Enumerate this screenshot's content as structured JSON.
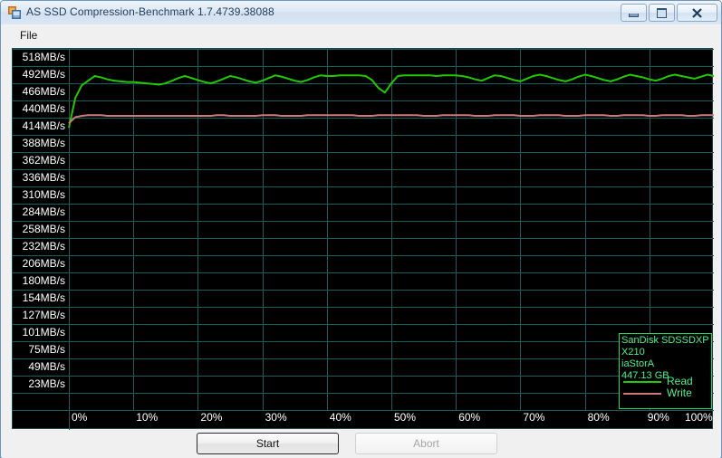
{
  "window": {
    "title": "AS SSD Compression-Benchmark 1.7.4739.38088",
    "icon": "app-icon",
    "controls": {
      "minimize": "Minimize",
      "maximize": "Maximize",
      "close": "Close"
    }
  },
  "menu": {
    "items": [
      {
        "label": "File"
      }
    ]
  },
  "legend": {
    "device_line1": "SanDisk SDSSDXP",
    "device_line2": "X210",
    "driver": "iaStorA",
    "capacity": "447.13 GB",
    "entries": [
      {
        "label": "Read",
        "color": "#22c800"
      },
      {
        "label": "Write",
        "color": "#cc7b7b"
      }
    ]
  },
  "buttons": {
    "start": "Start",
    "abort": "Abort"
  },
  "colors": {
    "read": "#22c800",
    "write": "#cc7b7b",
    "grid": "#1d5c5c",
    "plot_background": "#000000",
    "axis_text": "#ffffff",
    "legend_text": "#4df08a",
    "legend_border": "#2bd46b"
  },
  "chart_data": {
    "type": "line",
    "title": "",
    "xlabel": "",
    "ylabel": "",
    "grid": true,
    "legend_position": "bottom-right",
    "xlim": [
      0,
      100
    ],
    "ylim": [
      0,
      518
    ],
    "ytick_labels": [
      "518MB/s",
      "492MB/s",
      "466MB/s",
      "440MB/s",
      "414MB/s",
      "388MB/s",
      "362MB/s",
      "336MB/s",
      "310MB/s",
      "284MB/s",
      "258MB/s",
      "232MB/s",
      "206MB/s",
      "180MB/s",
      "154MB/s",
      "127MB/s",
      "101MB/s",
      "75MB/s",
      "49MB/s",
      "23MB/s"
    ],
    "ytick_values": [
      518,
      492,
      466,
      440,
      414,
      388,
      362,
      336,
      310,
      284,
      258,
      232,
      206,
      180,
      154,
      127,
      101,
      75,
      49,
      23
    ],
    "xtick_labels": [
      "0%",
      "10%",
      "20%",
      "30%",
      "40%",
      "50%",
      "60%",
      "70%",
      "80%",
      "90%",
      "100%"
    ],
    "xtick_values": [
      0,
      10,
      20,
      30,
      40,
      50,
      60,
      70,
      80,
      90,
      100
    ],
    "x": [
      0,
      1,
      2,
      3,
      4,
      5,
      6,
      7,
      8,
      9,
      10,
      11,
      12,
      13,
      14,
      15,
      16,
      17,
      18,
      19,
      20,
      21,
      22,
      23,
      24,
      25,
      26,
      27,
      28,
      29,
      30,
      31,
      32,
      33,
      34,
      35,
      36,
      37,
      38,
      39,
      40,
      41,
      42,
      43,
      44,
      45,
      46,
      47,
      48,
      49,
      50,
      51,
      52,
      53,
      54,
      55,
      56,
      57,
      58,
      59,
      60,
      61,
      62,
      63,
      64,
      65,
      66,
      67,
      68,
      69,
      70,
      71,
      72,
      73,
      74,
      75,
      76,
      77,
      78,
      79,
      80,
      81,
      82,
      83,
      84,
      85,
      86,
      87,
      88,
      89,
      90,
      91,
      92,
      93,
      94,
      95,
      96,
      97,
      98,
      99,
      100
    ],
    "series": [
      {
        "name": "Read",
        "color": "#22c800",
        "values": [
          425,
          470,
          489,
          496,
          503,
          501,
          498,
          496,
          495,
          494,
          494,
          493,
          492,
          491,
          490,
          492,
          496,
          500,
          503,
          500,
          497,
          494,
          492,
          495,
          499,
          503,
          501,
          498,
          495,
          493,
          496,
          500,
          504,
          502,
          499,
          496,
          494,
          497,
          501,
          504,
          503,
          503,
          504,
          504,
          504,
          504,
          503,
          497,
          485,
          478,
          492,
          503,
          504,
          504,
          504,
          504,
          504,
          503,
          504,
          504,
          504,
          503,
          501,
          498,
          496,
          500,
          504,
          503,
          500,
          497,
          495,
          499,
          503,
          505,
          503,
          500,
          497,
          495,
          498,
          502,
          505,
          503,
          500,
          497,
          495,
          498,
          502,
          505,
          503,
          501,
          498,
          496,
          499,
          503,
          505,
          503,
          501,
          499,
          502,
          505,
          503
        ]
      },
      {
        "name": "Write",
        "color": "#cc7b7b",
        "values": [
          432,
          441,
          443,
          444,
          444,
          444,
          443,
          443,
          443,
          443,
          443,
          443,
          443,
          443,
          443,
          443,
          443,
          443,
          443,
          443,
          443,
          443,
          443,
          444,
          444,
          443,
          443,
          443,
          443,
          443,
          444,
          444,
          444,
          443,
          443,
          443,
          443,
          444,
          444,
          444,
          444,
          444,
          444,
          444,
          444,
          443,
          443,
          443,
          444,
          444,
          444,
          444,
          444,
          444,
          444,
          443,
          443,
          443,
          444,
          444,
          444,
          444,
          444,
          443,
          443,
          443,
          444,
          444,
          444,
          444,
          443,
          443,
          443,
          444,
          444,
          444,
          444,
          443,
          443,
          443,
          444,
          444,
          444,
          444,
          443,
          443,
          444,
          444,
          444,
          444,
          443,
          443,
          444,
          444,
          444,
          444,
          443,
          443,
          444,
          444,
          444
        ]
      }
    ]
  }
}
